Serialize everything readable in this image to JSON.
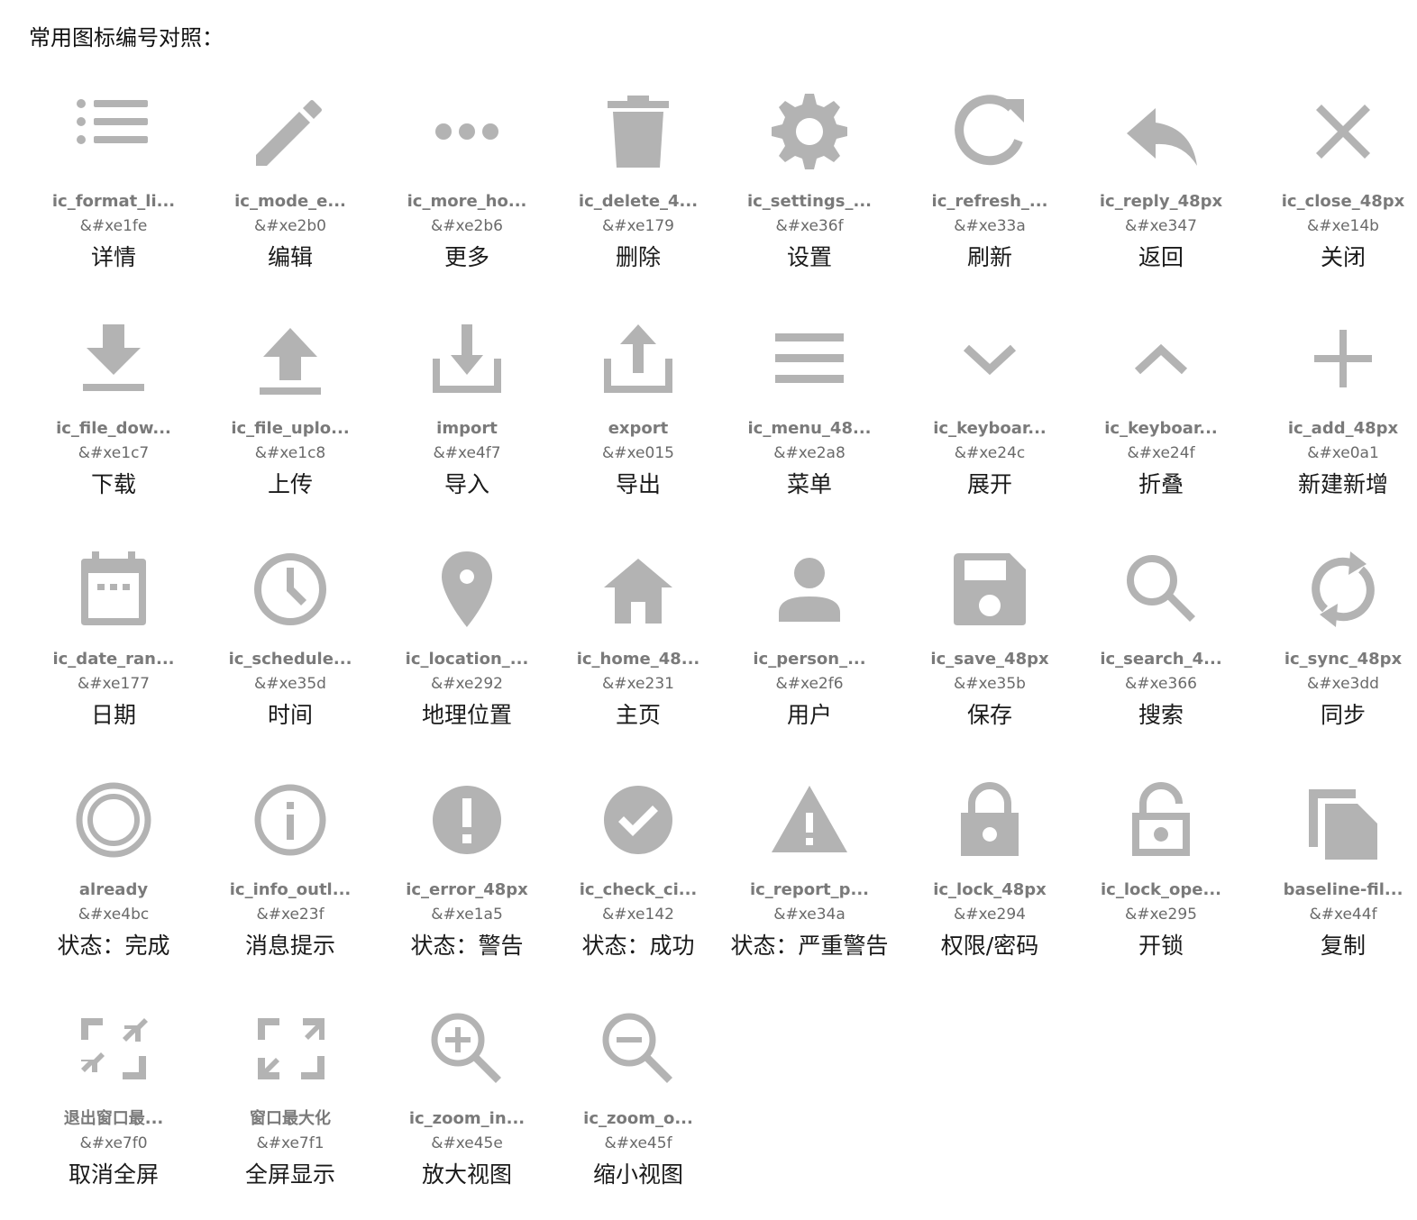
{
  "heading": "常用图标编号对照：",
  "icon_color": "#b3b3b3",
  "icons": [
    {
      "icon": "format-list-icon",
      "name": "ic_format_li...",
      "code": "&#xe1fe",
      "desc": "详情"
    },
    {
      "icon": "mode-edit-icon",
      "name": "ic_mode_e...",
      "code": "&#xe2b0",
      "desc": "编辑"
    },
    {
      "icon": "more-horiz-icon",
      "name": "ic_more_ho...",
      "code": "&#xe2b6",
      "desc": "更多"
    },
    {
      "icon": "delete-icon",
      "name": "ic_delete_4...",
      "code": "&#xe179",
      "desc": "删除"
    },
    {
      "icon": "settings-icon",
      "name": "ic_settings_...",
      "code": "&#xe36f",
      "desc": "设置"
    },
    {
      "icon": "refresh-icon",
      "name": "ic_refresh_...",
      "code": "&#xe33a",
      "desc": "刷新"
    },
    {
      "icon": "reply-icon",
      "name": "ic_reply_48px",
      "code": "&#xe347",
      "desc": "返回"
    },
    {
      "icon": "close-icon",
      "name": "ic_close_48px",
      "code": "&#xe14b",
      "desc": "关闭"
    },
    {
      "icon": "file-download-icon",
      "name": "ic_file_dow...",
      "code": "&#xe1c7",
      "desc": "下载"
    },
    {
      "icon": "file-upload-icon",
      "name": "ic_file_uplo...",
      "code": "&#xe1c8",
      "desc": "上传"
    },
    {
      "icon": "import-icon",
      "name": "import",
      "code": "&#xe4f7",
      "desc": "导入"
    },
    {
      "icon": "export-icon",
      "name": "export",
      "code": "&#xe015",
      "desc": "导出"
    },
    {
      "icon": "menu-icon",
      "name": "ic_menu_48...",
      "code": "&#xe2a8",
      "desc": "菜单"
    },
    {
      "icon": "chevron-down-icon",
      "name": "ic_keyboar...",
      "code": "&#xe24c",
      "desc": "展开"
    },
    {
      "icon": "chevron-up-icon",
      "name": "ic_keyboar...",
      "code": "&#xe24f",
      "desc": "折叠"
    },
    {
      "icon": "add-icon",
      "name": "ic_add_48px",
      "code": "&#xe0a1",
      "desc": "新建新增"
    },
    {
      "icon": "date-range-icon",
      "name": "ic_date_ran...",
      "code": "&#xe177",
      "desc": "日期"
    },
    {
      "icon": "schedule-icon",
      "name": "ic_schedule...",
      "code": "&#xe35d",
      "desc": "时间"
    },
    {
      "icon": "location-icon",
      "name": "ic_location_...",
      "code": "&#xe292",
      "desc": "地理位置"
    },
    {
      "icon": "home-icon",
      "name": "ic_home_48...",
      "code": "&#xe231",
      "desc": "主页"
    },
    {
      "icon": "person-icon",
      "name": "ic_person_...",
      "code": "&#xe2f6",
      "desc": "用户"
    },
    {
      "icon": "save-icon",
      "name": "ic_save_48px",
      "code": "&#xe35b",
      "desc": "保存"
    },
    {
      "icon": "search-icon",
      "name": "ic_search_4...",
      "code": "&#xe366",
      "desc": "搜索"
    },
    {
      "icon": "sync-icon",
      "name": "ic_sync_48px",
      "code": "&#xe3dd",
      "desc": "同步"
    },
    {
      "icon": "already-icon",
      "name": "already",
      "code": "&#xe4bc",
      "desc": "状态：完成"
    },
    {
      "icon": "info-outline-icon",
      "name": "ic_info_outl...",
      "code": "&#xe23f",
      "desc": "消息提示"
    },
    {
      "icon": "error-icon",
      "name": "ic_error_48px",
      "code": "&#xe1a5",
      "desc": "状态：警告"
    },
    {
      "icon": "check-circle-icon",
      "name": "ic_check_ci...",
      "code": "&#xe142",
      "desc": "状态：成功"
    },
    {
      "icon": "report-problem-icon",
      "name": "ic_report_p...",
      "code": "&#xe34a",
      "desc": "状态：严重警告"
    },
    {
      "icon": "lock-icon",
      "name": "ic_lock_48px",
      "code": "&#xe294",
      "desc": "权限/密码"
    },
    {
      "icon": "lock-open-icon",
      "name": "ic_lock_ope...",
      "code": "&#xe295",
      "desc": "开锁"
    },
    {
      "icon": "file-copy-icon",
      "name": "baseline-fil...",
      "code": "&#xe44f",
      "desc": "复制"
    },
    {
      "icon": "fullscreen-exit-icon",
      "name": "退出窗口最...",
      "code": "&#xe7f0",
      "desc": "取消全屏"
    },
    {
      "icon": "fullscreen-icon",
      "name": "窗口最大化",
      "code": "&#xe7f1",
      "desc": "全屏显示"
    },
    {
      "icon": "zoom-in-icon",
      "name": "ic_zoom_in...",
      "code": "&#xe45e",
      "desc": "放大视图"
    },
    {
      "icon": "zoom-out-icon",
      "name": "ic_zoom_o...",
      "code": "&#xe45f",
      "desc": "缩小视图"
    }
  ]
}
